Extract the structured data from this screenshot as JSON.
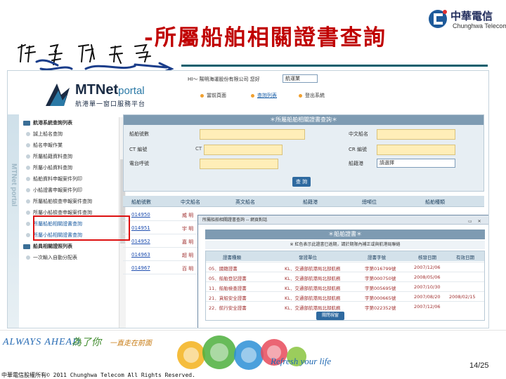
{
  "slide": {
    "title": "-所屬船舶相關證書查詢",
    "handwriting": "作業流程",
    "page_number": "14/25",
    "copyright": "中華電信股權所有© 2011 Chunghwa Telecom All Rights Reserved.",
    "logo": {
      "zh": "中華電信",
      "en": "Chunghwa Telecom"
    },
    "slogan": {
      "en": "ALWAYS AHEAD",
      "zh1": "為了你",
      "zh2": "一直走在前面"
    },
    "tagline": "Refresh your life"
  },
  "portal": {
    "brand": "MTNet",
    "brand_suffix": "portal",
    "brand_sub": "航港單一窗口服務平台",
    "company": "HI～ 陽明海運股份有限公司 您好",
    "port_select": "航運業",
    "nav": [
      "當前頁面",
      "查詢列表",
      "登出系統"
    ],
    "side_text": "MTNet portal"
  },
  "menu": {
    "items": [
      {
        "label": "航港系統查詢列表",
        "group": true
      },
      {
        "label": "誠上船名查詢",
        "group": false
      },
      {
        "label": "船名申報作業",
        "group": false
      },
      {
        "label": "所屬船籍資料查詢",
        "group": false
      },
      {
        "label": "所屬小船資料查詢",
        "group": false
      },
      {
        "label": "船舶資料申報案件列印",
        "group": false
      },
      {
        "label": "小船證書申報案件列印",
        "group": false
      },
      {
        "label": "所屬船舶檢查申報案件查詢",
        "group": false
      },
      {
        "label": "所屬小船檢查申報案件查詢",
        "group": false
      },
      {
        "label": "所屬船舶相關證書查詢",
        "group": false,
        "highlight": true
      },
      {
        "label": "所屬小船相關證書查詢",
        "group": false,
        "highlight": true
      },
      {
        "label": "船員相關證照列表",
        "group": true
      },
      {
        "label": "一次輸入自動分配表",
        "group": false
      }
    ]
  },
  "query_form": {
    "header": "＊所屬船舶相關證書查詢＊",
    "labels": {
      "ship_no": "船舶號數",
      "zh_name": "中文船名",
      "ct_no": "CT 編號",
      "cr_no": "CR 編號",
      "call_sign": "電台呼號",
      "registry": "船籍港"
    },
    "ct_prefix": "CT",
    "registry_value": "請選擇",
    "query_button": "查 詢"
  },
  "results": {
    "columns": [
      "船舶號數",
      "中文船名",
      "英文船名",
      "船籍港",
      "總噸位",
      "船舶種類"
    ],
    "rows": [
      {
        "ship_no": "014950",
        "zh_name": "威 明"
      },
      {
        "ship_no": "014951",
        "zh_name": "宇 明"
      },
      {
        "ship_no": "014952",
        "zh_name": "嘉 明"
      },
      {
        "ship_no": "014963",
        "zh_name": "超 明"
      },
      {
        "ship_no": "014967",
        "zh_name": "百 明"
      }
    ]
  },
  "popup": {
    "window_title": "所屬船舶相關證書查詢 -- 網頁對話",
    "header": "＊船舶證書＊",
    "sub_note": "※ 紅色表示此證書已逾期，請於期限內補正或與航港局聯絡",
    "columns": [
      "證書種類",
      "發證單位",
      "證書字號",
      "核發日期",
      "有效日期"
    ],
    "rows": [
      {
        "type": "05．國籍證書",
        "issuer": "KL．交通部航港局北部航務",
        "cert_no": "宇第016799號",
        "issued": "2007/12/06",
        "valid": ""
      },
      {
        "type": "05．船舶登記證書",
        "issuer": "KL．交通部航港局北部航務",
        "cert_no": "宇第000750號",
        "issued": "2008/05/06",
        "valid": ""
      },
      {
        "type": "11．船舶檢查證書",
        "issuer": "KL．交通部航港局北部航務",
        "cert_no": "宇第005695號",
        "issued": "2007/10/30",
        "valid": ""
      },
      {
        "type": "21．貨船安全證書",
        "issuer": "KL．交通部航港局北部航務",
        "cert_no": "宇第000665號",
        "issued": "2007/08/20",
        "valid": "2008/02/15"
      },
      {
        "type": "22．航行安全證書",
        "issuer": "KL．交通部航港局北部航務",
        "cert_no": "宇第022352號",
        "issued": "2007/12/06",
        "valid": ""
      }
    ],
    "close_button": "關閉視窗"
  },
  "colors": {
    "title_red": "#c00000",
    "header_blue": "#7e9bb2",
    "input_yellow": "#ffeeb8",
    "highlight_box": "#dd1111"
  }
}
